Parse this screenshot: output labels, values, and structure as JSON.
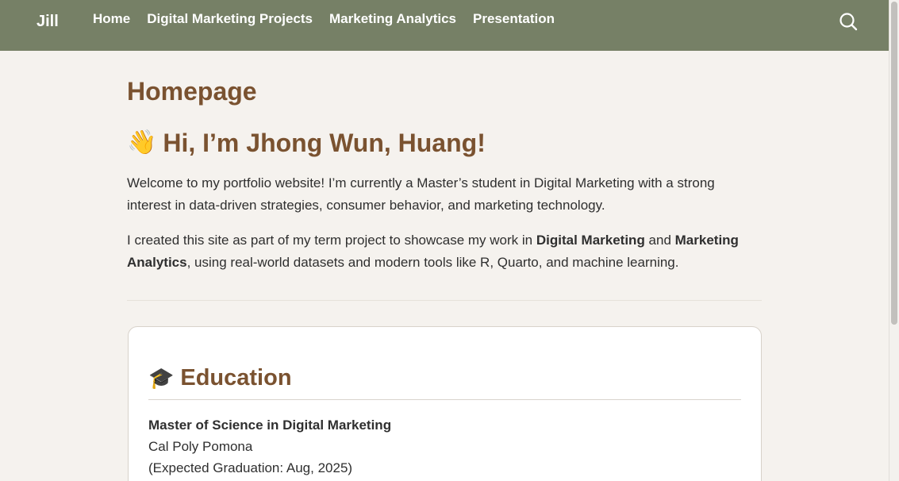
{
  "navbar": {
    "brand": "Jill",
    "links": [
      "Home",
      "Digital Marketing Projects",
      "Marketing Analytics",
      "Presentation"
    ],
    "bg_color": "#768066"
  },
  "main": {
    "title": "Homepage",
    "hero_emoji": "👋",
    "hero_text": "Hi, I’m Jhong Wun, Huang!",
    "p1": "Welcome to my portfolio website! I’m currently a Master’s student in Digital Marketing with a strong interest in data-driven strategies, consumer behavior, and marketing technology.",
    "p2_start": "I created this site as part of my term project to showcase my work in ",
    "p2_bold1": "Digital Marketing",
    "p2_mid": " and ",
    "p2_bold2": "Marketing Analytics",
    "p2_end": ", using real-world datasets and modern tools like R, Quarto, and machine learning."
  },
  "education": {
    "emoji": "🎓",
    "heading": "Education",
    "degree": "Master of Science in Digital Marketing",
    "school": "Cal Poly Pomona",
    "graduation": "(Expected Graduation: Aug, 2025)"
  },
  "colors": {
    "accent": "#7a5230",
    "page_bg": "#f5f2ee"
  }
}
